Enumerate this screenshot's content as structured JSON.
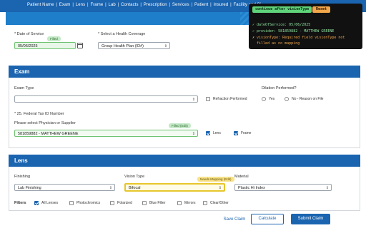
{
  "nav": {
    "links": [
      "Patient Name",
      "Exam",
      "Lens",
      "Frame",
      "Lab",
      "Contacts",
      "Prescription",
      "Services",
      "Patient",
      "Insured",
      "Facility and Bi"
    ],
    "separator": "|"
  },
  "header_fields": {
    "date_label": "* Date of Service",
    "date_badge": "Filled",
    "date_value": "05/06/2025",
    "coverage_label": "* Select a Health Coverage",
    "coverage_value": "Group Health Plan (ID#)"
  },
  "exam": {
    "title": "Exam",
    "exam_type_label": "Exam Type",
    "exam_type_value": "",
    "refraction_label": "Refraction Performed",
    "dilation_label": "Dilation Performed?",
    "dilation_yes": "Yes",
    "dilation_no": "No - Reason on File",
    "tax_label": "* 25. Federal Tax ID Number",
    "physician_label": "Please select Physician or Supplier",
    "physician_badge": "Filled (Edit)",
    "physician_value": "581859882 - MATTHEW GREENE",
    "lens_check_label": "Lens",
    "frame_check_label": "Frame"
  },
  "lens": {
    "title": "Lens",
    "finishing_label": "Finishing",
    "finishing_value": "Lab Finishing",
    "vision_label": "Vision Type",
    "vision_badge": "Needs Mapping (Edit)",
    "vision_value": "Bifocal",
    "material_label": "Material",
    "material_value": "Plastic Hi Index",
    "filters_label": "Filters",
    "filters": [
      "All Lenses",
      "Photochromics",
      "Polarized",
      "Blue Filter",
      "Mirrors",
      "Clear/Other"
    ]
  },
  "actions": {
    "save": "Save Claim",
    "calculate": "Calculate",
    "submit": "Submit Claim"
  },
  "overlay": {
    "continue_btn": "continue after visionType",
    "reset_btn": "Reset",
    "line1": "✓ dateOfService: 05/06/2025",
    "line2": "✓ provider: 581859882 - MATTHEW GREENE",
    "line3": "✗ visionType: Required field visionType not",
    "line4": "  filled as no mapping"
  },
  "colors": {
    "brand_blue": "#1a64b0",
    "filled_green": "#c5e9c7",
    "needs_mapping_yellow": "#f7e28a",
    "success_green": "#5fd37a",
    "error_orange": "#f0a64a"
  }
}
